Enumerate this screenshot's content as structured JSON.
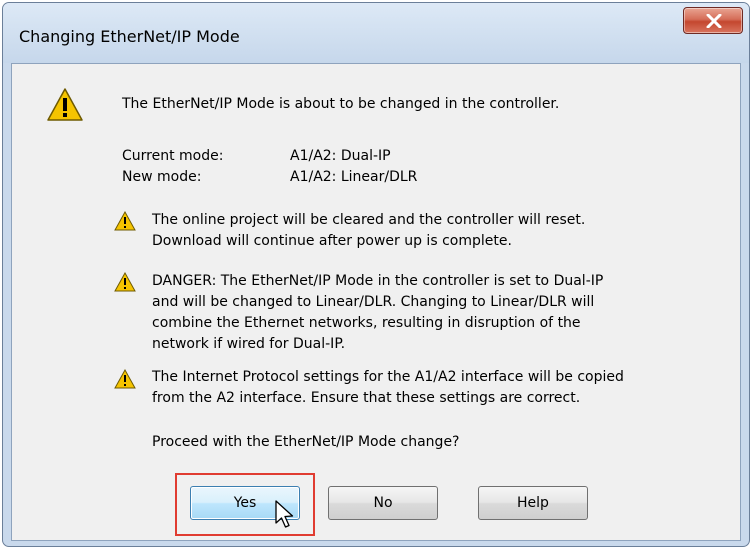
{
  "window": {
    "title": "Changing EtherNet/IP Mode",
    "close_glyph": "X"
  },
  "dialog": {
    "headline": "The EtherNet/IP Mode is about to be changed in the controller.",
    "current_mode_label": "Current mode:",
    "current_mode_value": "A1/A2: Dual-IP",
    "new_mode_label": "New mode:",
    "new_mode_value": "A1/A2: Linear/DLR",
    "warnings": [
      {
        "text": "The online project will be cleared and the controller will reset.\nDownload will continue after power up is complete."
      },
      {
        "text": "DANGER: The EtherNet/IP Mode in the controller is set to Dual-IP\nand will be changed to Linear/DLR. Changing to Linear/DLR will\ncombine the Ethernet networks, resulting in disruption of the\nnetwork if wired for Dual-IP."
      },
      {
        "text": "The Internet Protocol settings for the A1/A2 interface will be copied\nfrom the A2 interface. Ensure that these settings are correct."
      }
    ],
    "question": "Proceed with the EtherNet/IP Mode change?"
  },
  "buttons": {
    "yes": "Yes",
    "no": "No",
    "help": "Help"
  },
  "colors": {
    "highlight": "#e03c31",
    "warning_fill": "#f5c400",
    "close_button": "#c4472f"
  },
  "icons": {
    "large_warning": "warning-triangle-icon",
    "small_warning": "warning-triangle-icon",
    "close": "close-icon",
    "cursor": "mouse-pointer-icon"
  }
}
